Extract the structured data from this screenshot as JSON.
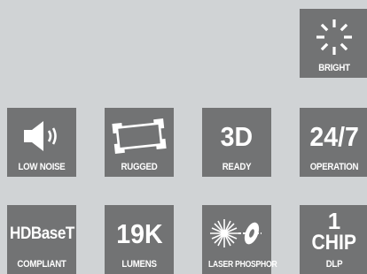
{
  "tiles": [
    {
      "id": "bright",
      "label": "BRIGHT",
      "icon": "sun-burst-icon"
    },
    {
      "id": "low-noise",
      "label": "LOW NOISE",
      "icon": "speaker-icon"
    },
    {
      "id": "rugged",
      "label": "RUGGED",
      "icon": "rugged-frame-icon"
    },
    {
      "id": "3d",
      "label": "READY",
      "big": "3D"
    },
    {
      "id": "247",
      "label": "OPERATION",
      "big": "24/7"
    },
    {
      "id": "hdbaset",
      "label": "COMPLIANT",
      "big": "HDBaseT"
    },
    {
      "id": "19k",
      "label": "LUMENS",
      "big": "19K"
    },
    {
      "id": "laser",
      "label": "LASER PHOSPHOR",
      "icon": "laser-phosphor-icon"
    },
    {
      "id": "chip",
      "label": "DLP",
      "big_line1": "1",
      "big_line2": "CHIP"
    }
  ],
  "colors": {
    "tile": "#727374",
    "background": "#d0d3d5",
    "text": "#ffffff"
  }
}
